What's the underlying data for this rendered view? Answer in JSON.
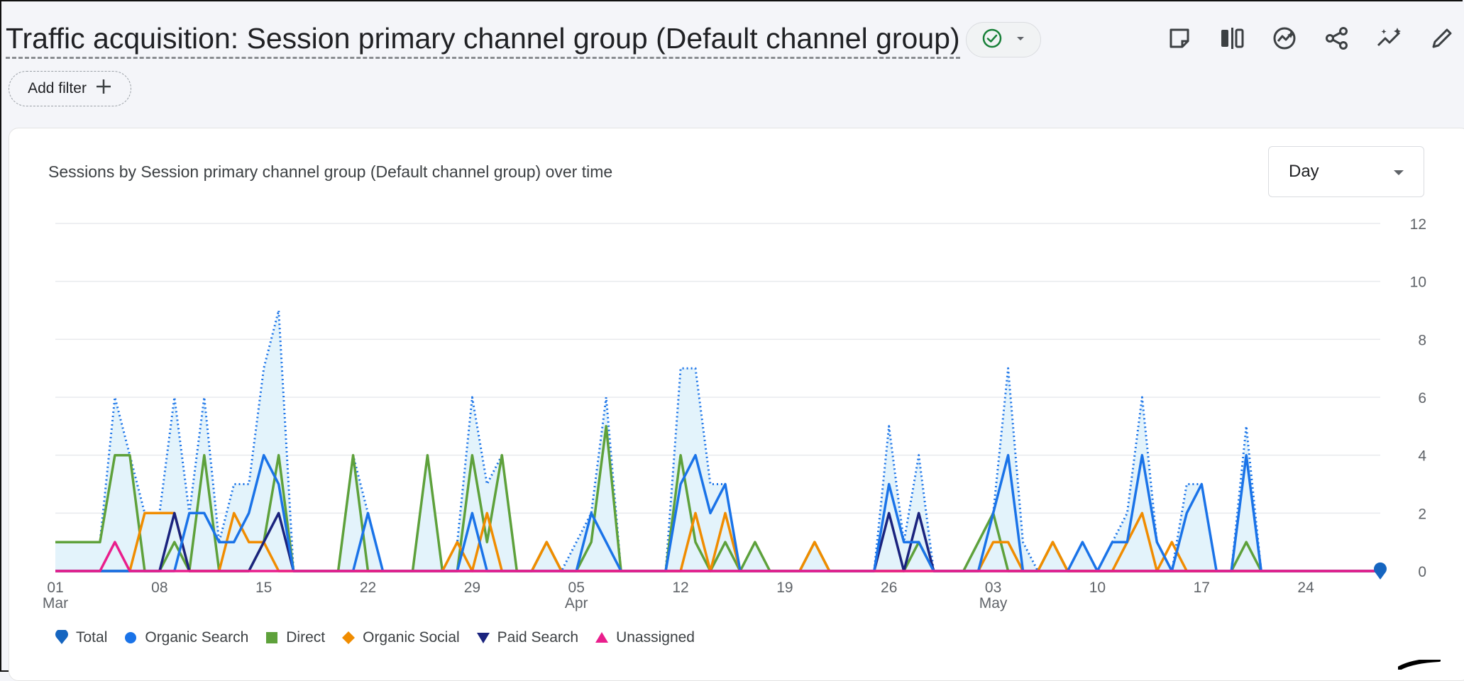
{
  "header": {
    "title": "Traffic acquisition: Session primary channel group (Default channel group)",
    "status_icon": "check-circle-icon",
    "toolbar_icons": [
      "note-icon",
      "compare-icon",
      "insights-icon",
      "share-icon",
      "sparkle-trend-icon",
      "edit-pencil-icon"
    ]
  },
  "filter": {
    "add_label": "Add filter"
  },
  "card": {
    "chart_title": "Sessions by Session primary channel group (Default channel group) over time",
    "interval": "Day"
  },
  "colors": {
    "total": "#1a73e8",
    "total_fill": "#e3f3fb",
    "organic_search": "#1a73e8",
    "direct": "#5ea13b",
    "organic_social": "#f08c00",
    "paid_search": "#1a237e",
    "unassigned": "#e91e8c",
    "grid": "#e8eaed",
    "total_marker": "#1565c0"
  },
  "chart_data": {
    "type": "line",
    "title": "Sessions by Session primary channel group (Default channel group) over time",
    "x_start": "2024-03-01",
    "x_end": "2024-05-29",
    "x_tick_labels": [
      {
        "date": "2024-03-01",
        "day": "01",
        "month": "Mar"
      },
      {
        "date": "2024-03-08",
        "day": "08",
        "month": ""
      },
      {
        "date": "2024-03-15",
        "day": "15",
        "month": ""
      },
      {
        "date": "2024-03-22",
        "day": "22",
        "month": ""
      },
      {
        "date": "2024-03-29",
        "day": "29",
        "month": ""
      },
      {
        "date": "2024-04-05",
        "day": "05",
        "month": "Apr"
      },
      {
        "date": "2024-04-12",
        "day": "12",
        "month": ""
      },
      {
        "date": "2024-04-19",
        "day": "19",
        "month": ""
      },
      {
        "date": "2024-04-26",
        "day": "26",
        "month": ""
      },
      {
        "date": "2024-05-03",
        "day": "03",
        "month": "May"
      },
      {
        "date": "2024-05-10",
        "day": "10",
        "month": ""
      },
      {
        "date": "2024-05-17",
        "day": "17",
        "month": ""
      },
      {
        "date": "2024-05-24",
        "day": "24",
        "month": ""
      }
    ],
    "y_ticks": [
      "0",
      "2",
      "4",
      "6",
      "8",
      "10",
      "12"
    ],
    "ylim": [
      0,
      12
    ],
    "y_axis_position": "right",
    "grid": true,
    "legend_position": "bottom-left",
    "series": [
      {
        "name": "Total",
        "style": "dotted-area",
        "values": [
          1,
          1,
          1,
          1,
          6,
          4,
          2,
          2,
          6,
          2,
          6,
          1,
          3,
          3,
          7,
          9,
          0,
          0,
          0,
          0,
          4,
          2,
          0,
          0,
          0,
          4,
          0,
          1,
          6,
          3,
          4,
          0,
          0,
          1,
          0,
          1,
          2,
          6,
          0,
          0,
          0,
          0,
          7,
          7,
          3,
          3,
          0,
          1,
          0,
          0,
          0,
          1,
          0,
          0,
          0,
          0,
          5,
          1,
          4,
          0,
          0,
          0,
          1,
          2,
          7,
          1,
          0,
          1,
          0,
          1,
          0,
          1,
          2,
          6,
          1,
          0,
          3,
          3,
          0,
          0,
          5,
          0,
          0,
          0,
          0,
          0,
          0,
          0,
          0,
          0
        ]
      },
      {
        "name": "Organic Search",
        "style": "line",
        "values": [
          0,
          0,
          0,
          0,
          0,
          0,
          0,
          0,
          0,
          2,
          2,
          1,
          1,
          2,
          4,
          3,
          0,
          0,
          0,
          0,
          0,
          2,
          0,
          0,
          0,
          0,
          0,
          0,
          2,
          0,
          0,
          0,
          0,
          0,
          0,
          0,
          2,
          1,
          0,
          0,
          0,
          0,
          3,
          4,
          2,
          3,
          0,
          0,
          0,
          0,
          0,
          0,
          0,
          0,
          0,
          0,
          3,
          1,
          1,
          0,
          0,
          0,
          0,
          2,
          4,
          0,
          0,
          0,
          0,
          1,
          0,
          1,
          1,
          4,
          1,
          0,
          2,
          3,
          0,
          0,
          4,
          0,
          0,
          0,
          0,
          0,
          0,
          0,
          0,
          0
        ]
      },
      {
        "name": "Direct",
        "style": "line",
        "values": [
          1,
          1,
          1,
          1,
          4,
          4,
          0,
          0,
          1,
          0,
          4,
          0,
          0,
          0,
          1,
          4,
          0,
          0,
          0,
          0,
          4,
          0,
          0,
          0,
          0,
          4,
          0,
          0,
          4,
          1,
          4,
          0,
          0,
          1,
          0,
          0,
          1,
          5,
          0,
          0,
          0,
          0,
          4,
          1,
          0,
          1,
          0,
          1,
          0,
          0,
          0,
          1,
          0,
          0,
          0,
          0,
          0,
          0,
          1,
          0,
          0,
          0,
          1,
          2,
          0,
          0,
          0,
          1,
          0,
          0,
          0,
          0,
          0,
          0,
          0,
          0,
          0,
          0,
          0,
          0,
          1,
          0,
          0,
          0,
          0,
          0,
          0,
          0,
          0,
          0
        ]
      },
      {
        "name": "Organic Social",
        "style": "line",
        "values": [
          0,
          0,
          0,
          0,
          0,
          0,
          2,
          2,
          2,
          0,
          0,
          0,
          2,
          1,
          1,
          0,
          0,
          0,
          0,
          0,
          0,
          0,
          0,
          0,
          0,
          0,
          0,
          1,
          0,
          2,
          0,
          0,
          0,
          1,
          0,
          0,
          0,
          0,
          0,
          0,
          0,
          0,
          0,
          2,
          0,
          2,
          0,
          0,
          0,
          0,
          0,
          1,
          0,
          0,
          0,
          0,
          0,
          0,
          0,
          0,
          0,
          0,
          0,
          1,
          1,
          0,
          0,
          1,
          0,
          0,
          0,
          0,
          1,
          2,
          0,
          1,
          0,
          0,
          0,
          0,
          0,
          0,
          0,
          0,
          0,
          0,
          0,
          0,
          0,
          0
        ]
      },
      {
        "name": "Paid Search",
        "style": "line",
        "values": [
          0,
          0,
          0,
          0,
          0,
          0,
          0,
          0,
          2,
          0,
          0,
          0,
          0,
          0,
          1,
          2,
          0,
          0,
          0,
          0,
          0,
          0,
          0,
          0,
          0,
          0,
          0,
          0,
          0,
          0,
          0,
          0,
          0,
          0,
          0,
          0,
          0,
          0,
          0,
          0,
          0,
          0,
          0,
          0,
          0,
          0,
          0,
          0,
          0,
          0,
          0,
          0,
          0,
          0,
          0,
          0,
          2,
          0,
          2,
          0,
          0,
          0,
          0,
          0,
          0,
          0,
          0,
          0,
          0,
          0,
          0,
          0,
          0,
          0,
          0,
          0,
          0,
          0,
          0,
          0,
          0,
          0,
          0,
          0,
          0,
          0,
          0,
          0,
          0,
          0
        ]
      },
      {
        "name": "Unassigned",
        "style": "line",
        "values": [
          0,
          0,
          0,
          0,
          1,
          0,
          0,
          0,
          0,
          0,
          0,
          0,
          0,
          0,
          0,
          0,
          0,
          0,
          0,
          0,
          0,
          0,
          0,
          0,
          0,
          0,
          0,
          0,
          0,
          0,
          0,
          0,
          0,
          0,
          0,
          0,
          0,
          0,
          0,
          0,
          0,
          0,
          0,
          0,
          0,
          0,
          0,
          0,
          0,
          0,
          0,
          0,
          0,
          0,
          0,
          0,
          0,
          0,
          0,
          0,
          0,
          0,
          0,
          0,
          0,
          0,
          0,
          0,
          0,
          0,
          0,
          0,
          0,
          0,
          0,
          0,
          0,
          0,
          0,
          0,
          0,
          0,
          0,
          0,
          0,
          0,
          0,
          0,
          0,
          0
        ]
      }
    ]
  },
  "legend": {
    "items": [
      {
        "label": "Total",
        "marker": "teardrop",
        "color_key": "total_marker"
      },
      {
        "label": "Organic Search",
        "marker": "circle",
        "color_key": "organic_search"
      },
      {
        "label": "Direct",
        "marker": "square",
        "color_key": "direct"
      },
      {
        "label": "Organic Social",
        "marker": "diamond",
        "color_key": "organic_social"
      },
      {
        "label": "Paid Search",
        "marker": "triangle-down",
        "color_key": "paid_search"
      },
      {
        "label": "Unassigned",
        "marker": "triangle-up",
        "color_key": "unassigned"
      }
    ]
  }
}
